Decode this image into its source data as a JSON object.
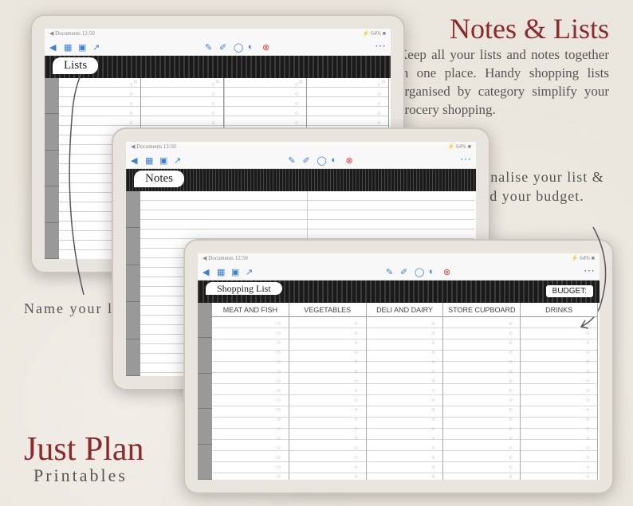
{
  "title": "Notes & Lists",
  "description": "Keep all your lists and notes together in one place. Handy shopping lists organised by category simplify your grocery shopping.",
  "personalise_text": "Personalise your list & add your budget.",
  "name_lists_text": "Name your lists.",
  "brand": {
    "top": "Just Plan",
    "bottom": "Printables"
  },
  "status": {
    "left": "◀ Documents  12:50",
    "right": "⚡ 64% ■"
  },
  "tablets": {
    "lists": {
      "label": "Lists"
    },
    "notes": {
      "label": "Notes"
    },
    "shopping": {
      "label": "Shopping List",
      "budget": "BUDGET:",
      "columns": [
        "MEAT AND FISH",
        "VEGETABLES",
        "DELI AND DAIRY",
        "STORE CUPBOARD",
        "DRINKS"
      ]
    }
  },
  "bullet_string": "○\n○\n○\n○\n○\n○\n○\n○\n○\n○\n○\n○\n○\n○\n○\n○\n○\n○"
}
